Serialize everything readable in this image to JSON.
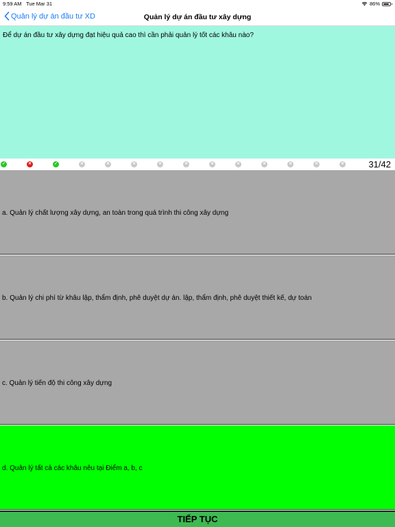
{
  "status_bar": {
    "time": "9:59 AM",
    "date": "Tue Mar 31",
    "battery": "86%",
    "battery_level": 0.86
  },
  "nav": {
    "back_label": "Quản lý dự án đầu tư XD",
    "title": "Quản lý dự án đầu tư xây dựng"
  },
  "question": {
    "text": "Để dự án đầu tư xây dựng đạt hiệu quả cao thì cần phải quản lý tốt các khâu nào?"
  },
  "progress": {
    "count": "31/42",
    "dots": [
      "correct",
      "wrong",
      "correct",
      "pending",
      "pending",
      "pending",
      "pending",
      "pending",
      "pending",
      "pending",
      "pending",
      "pending",
      "pending",
      "pending"
    ]
  },
  "answers": [
    {
      "label": "a. Quản lý chất lượng xây dựng, an toàn trong quá trình thi công xây dựng",
      "selected": false
    },
    {
      "label": "b. Quản lý chi phí từ khâu lập, thẩm định, phê duyệt dự án. lập, thẩm định, phê duyệt thiết kế, dự toán",
      "selected": false
    },
    {
      "label": "c. Quản lý tiến độ thi công xây dựng",
      "selected": false
    },
    {
      "label": "d. Quản lý tất cả các khâu nêu tại Điểm a, b, c",
      "selected": true
    }
  ],
  "footer": {
    "continue_label": "TIẾP TỤC"
  },
  "colors": {
    "question_bg": "#a0f7e0",
    "answer_bg": "#a9a8a9",
    "selected_bg": "#00ff00",
    "continue_bg": "#3dba52",
    "link": "#1a7df5"
  }
}
